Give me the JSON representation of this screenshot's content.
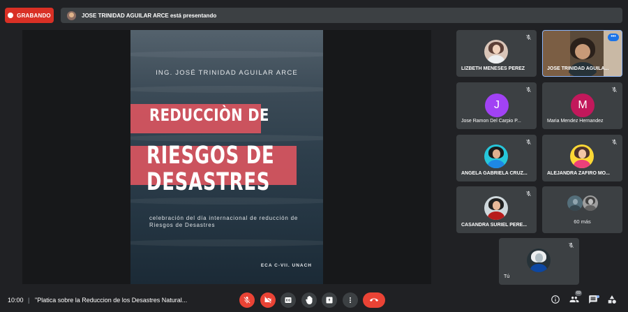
{
  "recording": {
    "label": "GRABANDO",
    "color": "#d93025"
  },
  "presenter_banner": {
    "text": "JOSE TRINIDAD AGUILAR ARCE está presentando"
  },
  "slide": {
    "author": "ING. JOSÉ TRINIDAD AGUILAR ARCE",
    "title_line1": "REDUCCIÒN DE",
    "title_line2": "RIESGOS DE",
    "title_line3": "DESASTRES",
    "subtitle": "celebración del día internacional de reducción de Riesgos de Desastres",
    "footer": "ECA C-VII. UNACH",
    "accent_color": "#d4545f"
  },
  "participants": [
    {
      "name": "LIZBETH MENESES PEREZ",
      "avatar": "photo",
      "muted": true
    },
    {
      "name": "JOSE TRINIDAD AGUILA...",
      "avatar": "video",
      "muted": false,
      "active_speaker": true,
      "menu_icon": "more-horiz-icon"
    },
    {
      "name": "Jose Ramon Del Carpio P...",
      "avatar": "letter",
      "letter": "J",
      "avatar_color": "#a142f4",
      "muted": true
    },
    {
      "name": "Maria Mendez Hernandez",
      "avatar": "letter",
      "letter": "M",
      "avatar_color": "#c2185b",
      "muted": true
    },
    {
      "name": "ANGELA GABRIELA CRUZ...",
      "avatar": "photo",
      "muted": true
    },
    {
      "name": "ALEJANDRA ZAFIRO MO...",
      "avatar": "photo",
      "muted": true
    },
    {
      "name": "CASANDRA SURIEL PERE...",
      "avatar": "photo",
      "muted": true
    },
    {
      "name": "60 más",
      "avatar": "group",
      "muted": false
    },
    {
      "name": "Tú",
      "avatar": "photo",
      "muted": true
    }
  ],
  "bottom_bar": {
    "time": "10:00",
    "separator": "|",
    "meeting_title": "\"Platica sobre la Reduccion de los Desastres Natural...",
    "controls": [
      {
        "name": "mic-off-icon",
        "state": "off"
      },
      {
        "name": "camera-off-icon",
        "state": "off"
      },
      {
        "name": "captions-icon"
      },
      {
        "name": "raise-hand-icon"
      },
      {
        "name": "present-screen-icon"
      },
      {
        "name": "more-vert-icon"
      },
      {
        "name": "end-call-icon"
      }
    ],
    "right_icons": [
      "info-icon",
      "people-icon",
      "chat-icon",
      "activities-icon"
    ],
    "people_count": "69"
  }
}
